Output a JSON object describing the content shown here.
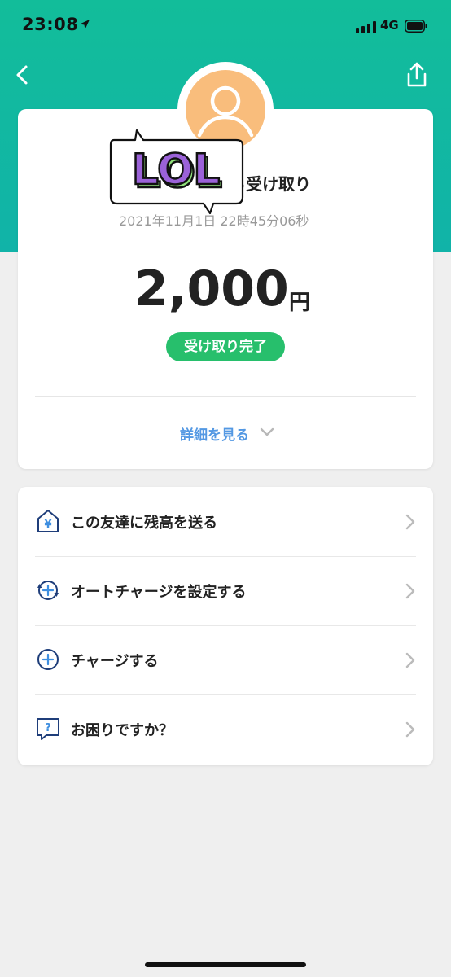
{
  "status_bar": {
    "time": "23:08",
    "network": "4G",
    "icons": [
      "location-arrow-icon",
      "signal-icon",
      "battery-icon"
    ]
  },
  "nav": {
    "back_icon": "chevron-left-icon",
    "share_icon": "share-icon"
  },
  "header_color": "#12bd9a",
  "transaction": {
    "avatar_icon": "person-icon",
    "sticker_text": "LOL",
    "sender_text": "ら受け取り",
    "date": "2021年11月1",
    "date_suffix": "日 22時45分06秒",
    "amount": "2,000",
    "currency": "円",
    "status": "受け取り完了",
    "status_color": "#27bf6c",
    "details_label": "詳細を見る"
  },
  "menu": {
    "items": [
      {
        "label": "この友達に残高を送る",
        "icon": "send-balance-icon"
      },
      {
        "label": "オートチャージを設定する",
        "icon": "auto-charge-icon"
      },
      {
        "label": "チャージする",
        "icon": "charge-plus-icon"
      },
      {
        "label": "お困りですか？",
        "icon": "help-question-icon"
      }
    ]
  },
  "accent_color": "#5398e3"
}
